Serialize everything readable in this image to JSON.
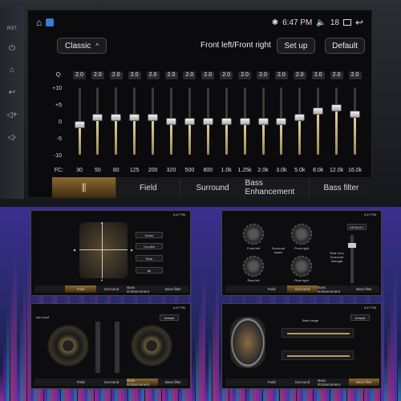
{
  "status": {
    "time": "6:47 PM",
    "volume": "18"
  },
  "header": {
    "preset": "Classic",
    "position_label": "Front left/Front right",
    "setup_label": "Set up",
    "default_label": "Default"
  },
  "eq": {
    "q_label": "Q:",
    "fc_label": "FC:",
    "y_ticks": [
      "+10",
      "+5",
      "0",
      "-5",
      "-10"
    ],
    "bands": [
      {
        "q": "2.0",
        "freq": "30",
        "gain": -1
      },
      {
        "q": "2.0",
        "freq": "50",
        "gain": 1
      },
      {
        "q": "2.0",
        "freq": "80",
        "gain": 1
      },
      {
        "q": "2.0",
        "freq": "125",
        "gain": 1
      },
      {
        "q": "2.0",
        "freq": "200",
        "gain": 1
      },
      {
        "q": "2.0",
        "freq": "320",
        "gain": 0
      },
      {
        "q": "2.0",
        "freq": "500",
        "gain": 0
      },
      {
        "q": "2.0",
        "freq": "800",
        "gain": 0
      },
      {
        "q": "2.0",
        "freq": "1.0k",
        "gain": 0
      },
      {
        "q": "2.0",
        "freq": "1.25k",
        "gain": 0
      },
      {
        "q": "2.0",
        "freq": "2.0k",
        "gain": 0
      },
      {
        "q": "2.0",
        "freq": "3.0k",
        "gain": 0
      },
      {
        "q": "2.0",
        "freq": "5.0k",
        "gain": 1
      },
      {
        "q": "2.0",
        "freq": "8.0k",
        "gain": 3
      },
      {
        "q": "2.0",
        "freq": "12.0k",
        "gain": 4
      },
      {
        "q": "2.0",
        "freq": "16.0k",
        "gain": 2
      }
    ]
  },
  "tabs": [
    "Field",
    "Surround",
    "Bass Enhancement",
    "Bass filter"
  ],
  "thumbs": {
    "field": {
      "time": "6:47 PM",
      "volume": "18",
      "buttons": [
        "Driver",
        "Co-pilot",
        "Rear",
        "All"
      ],
      "tabs": [
        "",
        "Field",
        "Surround",
        "Bass Enhancement",
        "Bass filter"
      ],
      "active": 1
    },
    "surround": {
      "time": "6:47 PM",
      "volume": "18",
      "default_label": "DEFAULT",
      "dials": [
        "Front left",
        "Front right",
        "Rear left",
        "Rear right"
      ],
      "space_label": "Surround space",
      "strength_label": "Rear horn Surround strength",
      "tabs": [
        "",
        "Field",
        "Surround",
        "Bass Enhancement",
        "Bass filter"
      ],
      "active": 2
    },
    "bass": {
      "time": "6:47 PM",
      "volume": "18",
      "title": "sub woof",
      "default_label": "Default",
      "tabs": [
        "",
        "Field",
        "Surround",
        "Bass Enhancement",
        "Bass filter"
      ],
      "active": 3
    },
    "filter": {
      "time": "6:47 PM",
      "volume": "18",
      "default_label": "Default",
      "range_label": "Bass range",
      "tabs": [
        "",
        "Field",
        "Surround",
        "Bass Enhancement",
        "Bass filter"
      ],
      "active": 4
    }
  },
  "colors": {
    "accent": "#8b6a30",
    "slider": "#e8d9a8",
    "purple_bg": "#3c2e8e"
  }
}
